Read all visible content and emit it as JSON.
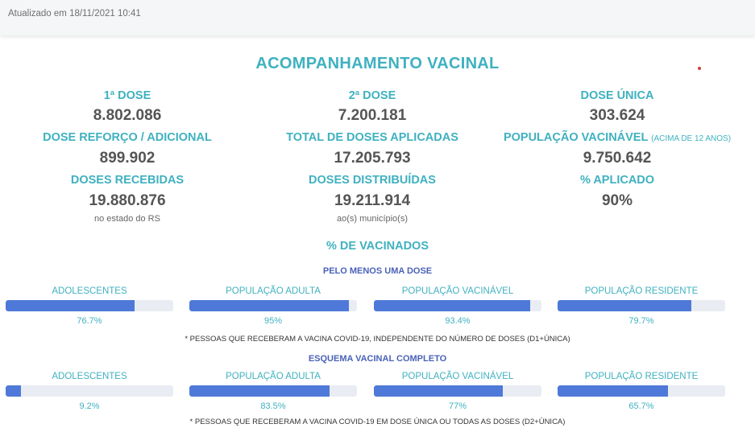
{
  "header": {
    "updated": "Atualizado em 18/11/2021 10:41"
  },
  "title": "ACOMPANHAMENTO VACINAL",
  "stats": [
    {
      "label": "1ª DOSE",
      "value": "8.802.086"
    },
    {
      "label": "2ª DOSE",
      "value": "7.200.181"
    },
    {
      "label": "DOSE ÚNICA",
      "value": "303.624"
    },
    {
      "label": "DOSE REFORÇO / ADICIONAL",
      "value": "899.902"
    },
    {
      "label": "TOTAL DE DOSES APLICADAS",
      "value": "17.205.793"
    },
    {
      "label": "POPULAÇÃO VACINÁVEL",
      "label_small": "(ACIMA DE 12 ANOS)",
      "value": "9.750.642"
    },
    {
      "label": "DOSES RECEBIDAS",
      "value": "19.880.876",
      "note": "no estado do RS"
    },
    {
      "label": "DOSES DISTRIBUÍDAS",
      "value": "19.211.914",
      "note": "ao(s) município(s)"
    },
    {
      "label": "% APLICADO",
      "value": "90%"
    }
  ],
  "vaccinated": {
    "title": "% DE VACINADOS",
    "at_least_one": {
      "title": "PELO MENOS UMA DOSE",
      "bars": [
        {
          "label": "ADOLESCENTES",
          "pct": 76.7,
          "pct_label": "76.7%"
        },
        {
          "label": "POPULAÇÃO ADULTA",
          "pct": 95,
          "pct_label": "95%"
        },
        {
          "label": "POPULAÇÃO VACINÁVEL",
          "pct": 93.4,
          "pct_label": "93.4%"
        },
        {
          "label": "POPULAÇÃO RESIDENTE",
          "pct": 79.7,
          "pct_label": "79.7%"
        }
      ],
      "footnote": "* PESSOAS QUE RECEBERAM A VACINA COVID-19, INDEPENDENTE DO NÚMERO DE DOSES (D1+ÚNICA)"
    },
    "complete": {
      "title": "ESQUEMA VACINAL COMPLETO",
      "bars": [
        {
          "label": "ADOLESCENTES",
          "pct": 9.2,
          "pct_label": "9.2%"
        },
        {
          "label": "POPULAÇÃO ADULTA",
          "pct": 83.5,
          "pct_label": "83.5%"
        },
        {
          "label": "POPULAÇÃO VACINÁVEL",
          "pct": 77,
          "pct_label": "77%"
        },
        {
          "label": "POPULAÇÃO RESIDENTE",
          "pct": 65.7,
          "pct_label": "65.7%"
        }
      ],
      "footnote": "* PESSOAS QUE RECEBERAM A VACINA COVID-19 EM DOSE ÚNICA OU TODAS AS DOSES (D2+ÚNICA)"
    }
  },
  "colors": {
    "accent": "#3fb1c0",
    "bar": "#4f79d8",
    "track": "#e9ecf2",
    "subtitle": "#4a62b8"
  }
}
